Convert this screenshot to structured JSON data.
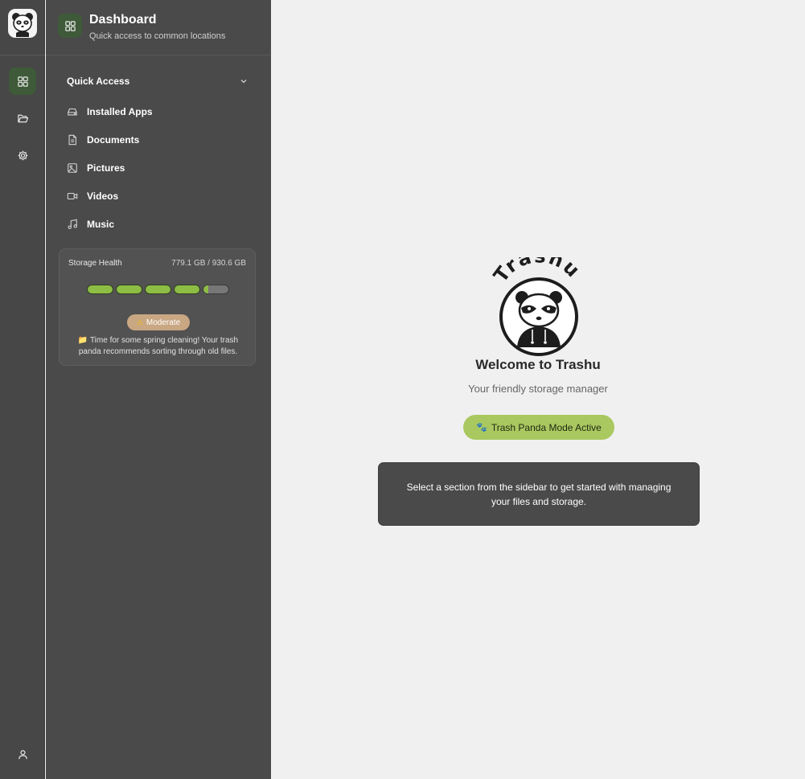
{
  "app": {
    "logo_icon": "raccoon-panda-logo"
  },
  "rail": {
    "items": [
      {
        "icon": "dashboard-grid-icon",
        "active": true
      },
      {
        "icon": "folder-open-icon",
        "active": false
      },
      {
        "icon": "gear-icon",
        "active": false
      }
    ],
    "profile_icon": "user-icon"
  },
  "panel": {
    "title": "Dashboard",
    "subtitle": "Quick access to common locations",
    "quick_access": {
      "heading": "Quick Access",
      "items": [
        {
          "label": "Installed Apps",
          "icon": "drive-icon"
        },
        {
          "label": "Documents",
          "icon": "document-icon"
        },
        {
          "label": "Pictures",
          "icon": "image-icon"
        },
        {
          "label": "Videos",
          "icon": "video-icon"
        },
        {
          "label": "Music",
          "icon": "music-note-icon"
        }
      ]
    },
    "storage_health": {
      "label": "Storage Health",
      "usage": "779.1 GB / 930.6 GB",
      "used_fraction": 0.837,
      "segments": 5,
      "status": "Moderate",
      "message_icon": "📁",
      "message": "Time for some spring cleaning! Your trash panda recommends sorting through old files."
    }
  },
  "main": {
    "logo_text": "Trashu",
    "welcome": "Welcome to Trashu",
    "tagline": "Your friendly storage manager",
    "mode_button": "Trash Panda Mode Active",
    "mode_icon": "🐾",
    "info": "Select a section from the sidebar to get started with managing your files and storage."
  },
  "colors": {
    "accent_green": "#a9c860",
    "bar_green": "#8dbd45",
    "sidebar_bg": "#4a4a4a",
    "badge_bg": "#c9a783"
  }
}
